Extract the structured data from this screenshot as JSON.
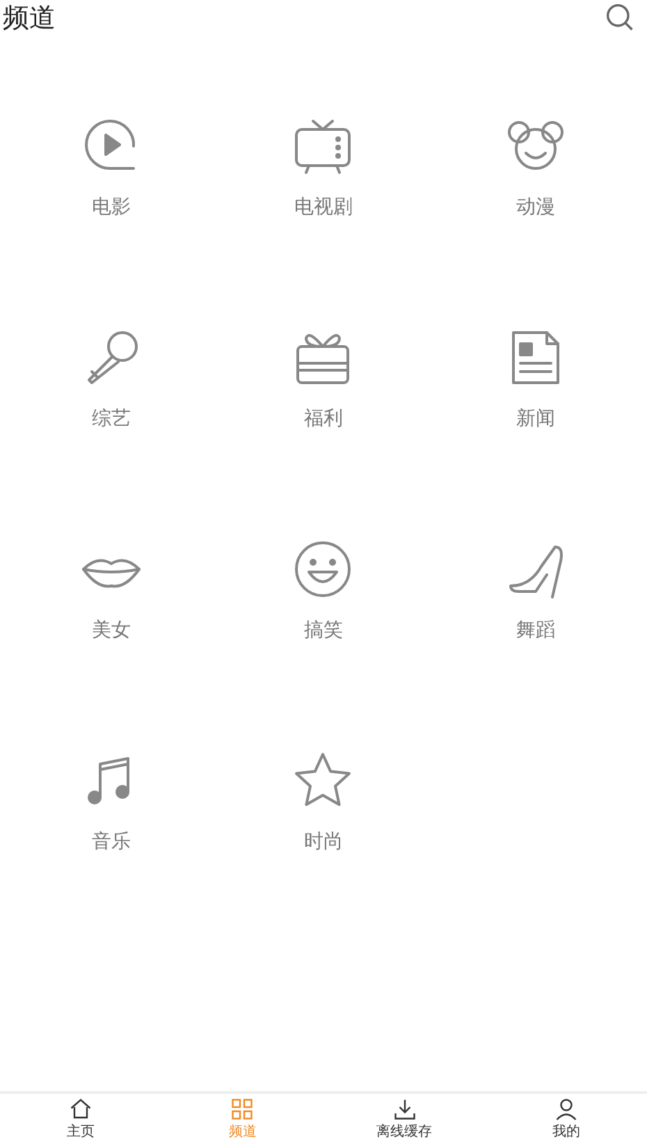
{
  "header": {
    "title": "频道"
  },
  "channels": [
    {
      "label": "电影"
    },
    {
      "label": "电视剧"
    },
    {
      "label": "动漫"
    },
    {
      "label": "综艺"
    },
    {
      "label": "福利"
    },
    {
      "label": "新闻"
    },
    {
      "label": "美女"
    },
    {
      "label": "搞笑"
    },
    {
      "label": "舞蹈"
    },
    {
      "label": "音乐"
    },
    {
      "label": "时尚"
    }
  ],
  "tab_bar": [
    {
      "label": "主页",
      "selected": false
    },
    {
      "label": "频道",
      "selected": true
    },
    {
      "label": "离线缓存",
      "selected": false
    },
    {
      "label": "我的",
      "selected": false
    }
  ]
}
